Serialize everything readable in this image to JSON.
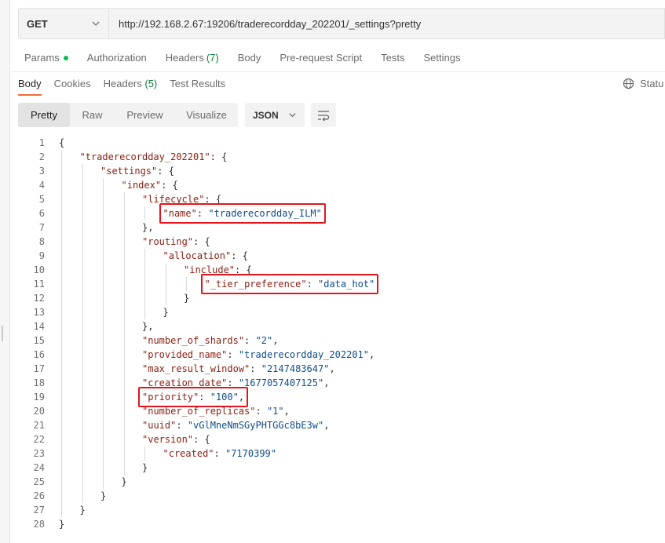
{
  "request": {
    "method": "GET",
    "url": "http://192.168.2.67:19206/traderecordday_202201/_settings?pretty"
  },
  "request_tabs": [
    {
      "label": "Params",
      "indicator": "green-dot"
    },
    {
      "label": "Authorization"
    },
    {
      "label": "Headers",
      "count": "(7)"
    },
    {
      "label": "Body"
    },
    {
      "label": "Pre-request Script"
    },
    {
      "label": "Tests"
    },
    {
      "label": "Settings"
    }
  ],
  "response_tabs": [
    {
      "label": "Body",
      "active": true
    },
    {
      "label": "Cookies"
    },
    {
      "label": "Headers",
      "count": "(5)"
    },
    {
      "label": "Test Results"
    }
  ],
  "status": {
    "label": "Statu",
    "icon": "globe-icon"
  },
  "view_modes": [
    "Pretty",
    "Raw",
    "Preview",
    "Visualize"
  ],
  "active_view": "Pretty",
  "format": "JSON",
  "wrap_icon": "wrap-lines-icon",
  "code_lines": [
    {
      "n": "1",
      "indent": 0,
      "parts": [
        [
          "p",
          "{"
        ]
      ]
    },
    {
      "n": "2",
      "indent": 1,
      "parts": [
        [
          "k",
          "\"traderecordday_202201\""
        ],
        [
          "p",
          ": {"
        ]
      ]
    },
    {
      "n": "3",
      "indent": 2,
      "parts": [
        [
          "k",
          "\"settings\""
        ],
        [
          "p",
          ": {"
        ]
      ]
    },
    {
      "n": "4",
      "indent": 3,
      "parts": [
        [
          "k",
          "\"index\""
        ],
        [
          "p",
          ": {"
        ]
      ]
    },
    {
      "n": "5",
      "indent": 4,
      "parts": [
        [
          "k",
          "\"lifecycle\""
        ],
        [
          "p",
          ": {"
        ]
      ]
    },
    {
      "n": "6",
      "indent": 5,
      "parts": [
        [
          "k",
          "\"name\""
        ],
        [
          "p",
          ": "
        ],
        [
          "s",
          "\"traderecordday_ILM\""
        ]
      ]
    },
    {
      "n": "7",
      "indent": 4,
      "parts": [
        [
          "p",
          "},"
        ]
      ]
    },
    {
      "n": "8",
      "indent": 4,
      "parts": [
        [
          "k",
          "\"routing\""
        ],
        [
          "p",
          ": {"
        ]
      ]
    },
    {
      "n": "9",
      "indent": 5,
      "parts": [
        [
          "k",
          "\"allocation\""
        ],
        [
          "p",
          ": {"
        ]
      ]
    },
    {
      "n": "10",
      "indent": 6,
      "parts": [
        [
          "k",
          "\"include\""
        ],
        [
          "p",
          ": {"
        ]
      ]
    },
    {
      "n": "11",
      "indent": 7,
      "parts": [
        [
          "k",
          "\"_tier_preference\""
        ],
        [
          "p",
          ": "
        ],
        [
          "s",
          "\"data_hot\""
        ]
      ]
    },
    {
      "n": "12",
      "indent": 6,
      "parts": [
        [
          "p",
          "}"
        ]
      ]
    },
    {
      "n": "13",
      "indent": 5,
      "parts": [
        [
          "p",
          "}"
        ]
      ]
    },
    {
      "n": "14",
      "indent": 4,
      "parts": [
        [
          "p",
          "},"
        ]
      ]
    },
    {
      "n": "15",
      "indent": 4,
      "parts": [
        [
          "k",
          "\"number_of_shards\""
        ],
        [
          "p",
          ": "
        ],
        [
          "s",
          "\"2\""
        ],
        [
          "p",
          ","
        ]
      ]
    },
    {
      "n": "16",
      "indent": 4,
      "parts": [
        [
          "k",
          "\"provided_name\""
        ],
        [
          "p",
          ": "
        ],
        [
          "s",
          "\"traderecordday_202201\""
        ],
        [
          "p",
          ","
        ]
      ]
    },
    {
      "n": "17",
      "indent": 4,
      "parts": [
        [
          "k",
          "\"max_result_window\""
        ],
        [
          "p",
          ": "
        ],
        [
          "s",
          "\"2147483647\""
        ],
        [
          "p",
          ","
        ]
      ]
    },
    {
      "n": "18",
      "indent": 4,
      "parts": [
        [
          "k",
          "\"creation_date\""
        ],
        [
          "p",
          ": "
        ],
        [
          "s",
          "\"1677057407125\""
        ],
        [
          "p",
          ","
        ]
      ]
    },
    {
      "n": "19",
      "indent": 4,
      "parts": [
        [
          "k",
          "\"priority\""
        ],
        [
          "p",
          ": "
        ],
        [
          "s",
          "\"100\""
        ],
        [
          "p",
          ","
        ]
      ]
    },
    {
      "n": "20",
      "indent": 4,
      "parts": [
        [
          "k",
          "\"number_of_replicas\""
        ],
        [
          "p",
          ": "
        ],
        [
          "s",
          "\"1\""
        ],
        [
          "p",
          ","
        ]
      ]
    },
    {
      "n": "21",
      "indent": 4,
      "parts": [
        [
          "k",
          "\"uuid\""
        ],
        [
          "p",
          ": "
        ],
        [
          "s",
          "\"vGlMneNmSGyPHTGGc8bE3w\""
        ],
        [
          "p",
          ","
        ]
      ]
    },
    {
      "n": "22",
      "indent": 4,
      "parts": [
        [
          "k",
          "\"version\""
        ],
        [
          "p",
          ": {"
        ]
      ]
    },
    {
      "n": "23",
      "indent": 5,
      "parts": [
        [
          "k",
          "\"created\""
        ],
        [
          "p",
          ": "
        ],
        [
          "s",
          "\"7170399\""
        ]
      ]
    },
    {
      "n": "24",
      "indent": 4,
      "parts": [
        [
          "p",
          "}"
        ]
      ]
    },
    {
      "n": "25",
      "indent": 3,
      "parts": [
        [
          "p",
          "}"
        ]
      ]
    },
    {
      "n": "26",
      "indent": 2,
      "parts": [
        [
          "p",
          "}"
        ]
      ]
    },
    {
      "n": "27",
      "indent": 1,
      "parts": [
        [
          "p",
          "}"
        ]
      ]
    },
    {
      "n": "28",
      "indent": 0,
      "parts": [
        [
          "p",
          "}"
        ]
      ]
    }
  ],
  "highlighted_lines": [
    "6",
    "11",
    "19"
  ],
  "colors": {
    "highlight_border": "#e5141b",
    "active_tab_underline": "#f26b3a",
    "json_key": "#8a1f11",
    "json_string": "#0e4d8c",
    "count_green": "#0a7d3d"
  }
}
